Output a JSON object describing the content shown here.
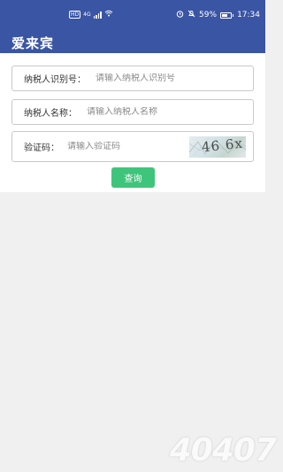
{
  "status_bar": {
    "network_badge": "HD",
    "network_type": "4G",
    "battery_percent": "59%",
    "time": "17:34",
    "icons": [
      "hd-icon",
      "signal-icon",
      "wifi-icon",
      "alarm-icon",
      "mute-icon",
      "battery-icon"
    ]
  },
  "app_bar": {
    "title": "爱来宾"
  },
  "form": {
    "taxpayer_id": {
      "label": "纳税人识别号：",
      "placeholder": "请输入纳税人识别号",
      "value": ""
    },
    "taxpayer_name": {
      "label": "纳税人名称：",
      "placeholder": "请输入纳税人名称",
      "value": ""
    },
    "captcha": {
      "label": "验证码：",
      "placeholder": "请输入验证码",
      "value": "",
      "image_text": "46 6x"
    },
    "submit_label": "查询"
  },
  "watermark": {
    "text": "40407"
  },
  "colors": {
    "primary": "#3a55a4",
    "button": "#3fc57b",
    "background": "#f0f0f0"
  }
}
